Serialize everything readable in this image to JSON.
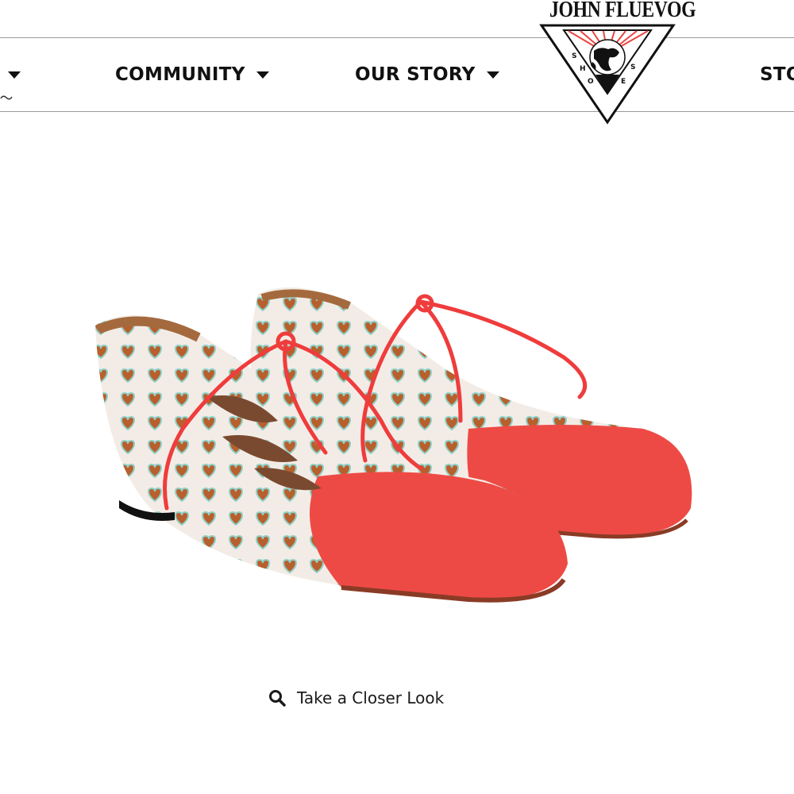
{
  "nav": {
    "left_partial_caret": "caret-down-icon",
    "items": [
      {
        "label": "COMMUNITY"
      },
      {
        "label": "OUR STORY"
      }
    ],
    "right_partial": "STO"
  },
  "logo": {
    "wordmark": "JOHN FLUEVOG",
    "letters": [
      "S",
      "H",
      "O",
      "E",
      "S"
    ]
  },
  "product": {
    "image_icon": "red-lace-up-shoes-image"
  },
  "closer_look": {
    "icon": "search-icon",
    "label": "Take a Closer Look"
  },
  "colors": {
    "accent_red": "#ee4a45",
    "nav_text": "#111111",
    "border": "#9a9a9a"
  }
}
